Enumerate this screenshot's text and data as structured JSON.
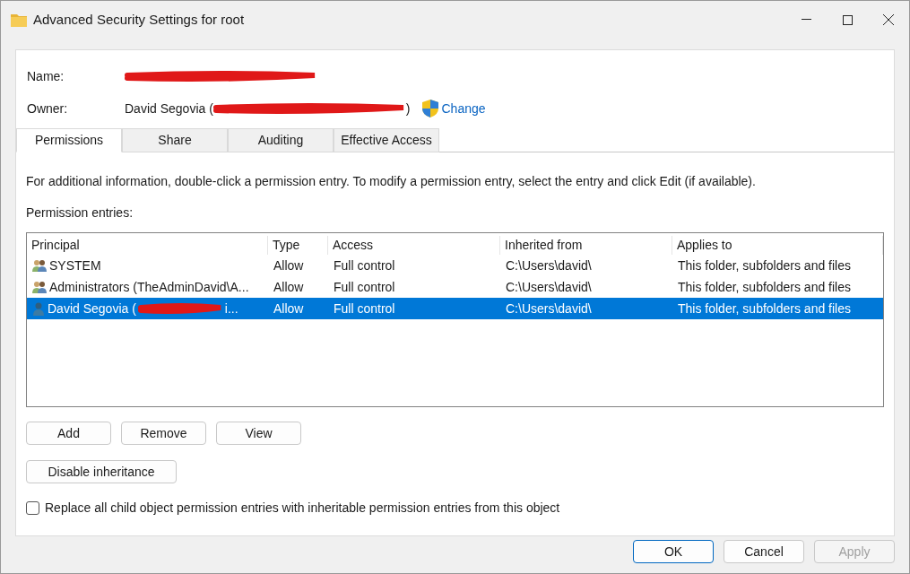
{
  "window": {
    "title": "Advanced Security Settings for root"
  },
  "name_label": "Name:",
  "owner": {
    "label": "Owner:",
    "value_start": "David Segovia (",
    "redacted": true,
    "value_end": ")",
    "change_link": "Change"
  },
  "tabs": [
    {
      "label": "Permissions",
      "selected": true
    },
    {
      "label": "Share",
      "selected": false
    },
    {
      "label": "Auditing",
      "selected": false
    },
    {
      "label": "Effective Access",
      "selected": false
    }
  ],
  "info": "For additional information, double-click a permission entry. To modify a permission entry, select the entry and click Edit (if available).",
  "entries_label": "Permission entries:",
  "table": {
    "columns": [
      "Principal",
      "Type",
      "Access",
      "Inherited from",
      "Applies to"
    ],
    "rows": [
      {
        "kind": "group",
        "principal": "SYSTEM",
        "redacted": false,
        "type": "Allow",
        "access": "Full control",
        "inherited_from": "C:\\Users\\david\\",
        "applies_to": "This folder, subfolders and files",
        "selected": false
      },
      {
        "kind": "group",
        "principal": "Administrators (TheAdminDavid\\A...",
        "redacted": false,
        "type": "Allow",
        "access": "Full control",
        "inherited_from": "C:\\Users\\david\\",
        "applies_to": "This folder, subfolders and files",
        "selected": false
      },
      {
        "kind": "user",
        "principal": "David Segovia (",
        "redacted": true,
        "principal_end": "i...",
        "type": "Allow",
        "access": "Full control",
        "inherited_from": "C:\\Users\\david\\",
        "applies_to": "This folder, subfolders and files",
        "selected": true
      }
    ]
  },
  "entry_buttons": [
    "Add",
    "Remove",
    "View"
  ],
  "inheritance_button": "Disable inheritance",
  "replace_option": {
    "label": "Replace all child object permission entries with inheritable permission entries from this object",
    "checked": false
  },
  "footer_buttons": [
    {
      "label": "OK",
      "disabled": false,
      "default": true
    },
    {
      "label": "Cancel",
      "disabled": false,
      "default": false
    },
    {
      "label": "Apply",
      "disabled": true,
      "default": false
    }
  ]
}
